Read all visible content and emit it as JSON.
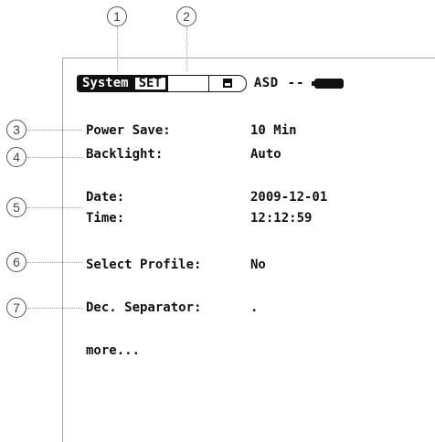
{
  "callouts": [
    "1",
    "2",
    "3",
    "4",
    "5",
    "6",
    "7"
  ],
  "statusbar": {
    "tab_system": "System",
    "tab_set": "SET",
    "mode": "ASD",
    "signal": "--",
    "save_icon": "floppy-disk-icon",
    "battery_icon": "battery-icon"
  },
  "settings": {
    "power_save": {
      "label": "Power Save:",
      "value": "10 Min"
    },
    "backlight": {
      "label": "Backlight:",
      "value": "Auto"
    },
    "date": {
      "label": "Date:",
      "value": "2009-12-01"
    },
    "time": {
      "label": "Time:",
      "value": "12:12:59"
    },
    "select_profile": {
      "label": "Select Profile:",
      "value": "No"
    },
    "dec_separator": {
      "label": "Dec. Separator:",
      "value": "."
    },
    "more": "more..."
  }
}
